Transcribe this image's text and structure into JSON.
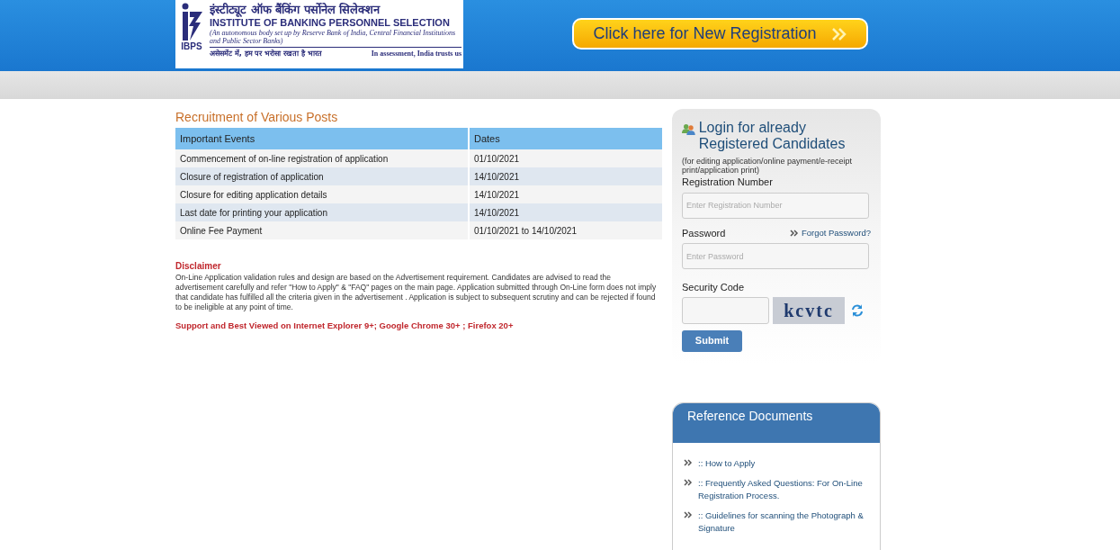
{
  "header": {
    "logo": {
      "mark": "IBPS",
      "hindi_title": "इंस्टीट्यूट ऑफ बैंकिंग पर्सोनेल सिलेक्शन",
      "title": "INSTITUTE OF BANKING PERSONNEL SELECTION",
      "subtitle": "(An autonomous body set up by Reserve Bank of India, Central Financial Institutions and Public Sector Banks)",
      "hindi_tagline": "असेसमेंट में, हम पर भरोसा रखता है भारत",
      "tagline": "In assessment, India trusts us"
    },
    "register_button": "Click here for New Registration"
  },
  "recruitment": {
    "title": "Recruitment of Various Posts",
    "columns": [
      "Important Events",
      "Dates"
    ],
    "rows": [
      [
        "Commencement of on-line registration of application",
        "01/10/2021"
      ],
      [
        "Closure of registration of application",
        "14/10/2021"
      ],
      [
        "Closure for editing application details",
        "14/10/2021"
      ],
      [
        "Last date for printing your application",
        "14/10/2021"
      ],
      [
        "Online Fee Payment",
        "01/10/2021 to 14/10/2021"
      ]
    ]
  },
  "disclaimer": {
    "title": "Disclaimer",
    "text": "On-Line Application validation rules and design are based on the Advertisement requirement. Candidates are advised to read the advertisement carefully and refer \"How to Apply\" & \"FAQ\" pages on the main page. Application submitted through On-Line form does not imply that candidate has fulfilled all the criteria given in the advertisement . Application is subject to subsequent scrutiny and can be rejected if found to be ineligible at any point of time.",
    "support": "Support and Best Viewed on Internet Explorer 9+; Google Chrome 30+ ; Firefox 20+"
  },
  "login": {
    "title": "Login for already Registered Candidates",
    "note": "(for editing application/online payment/e-receipt print/application print)",
    "registration_label": "Registration Number",
    "registration_placeholder": "Enter Registration Number",
    "password_label": "Password",
    "forgot_link": "Forgot Password?",
    "password_placeholder": "Enter Password",
    "security_label": "Security Code",
    "captcha": "kcvtc",
    "submit": "Submit"
  },
  "reference": {
    "title": "Reference Documents",
    "links": [
      ":: How to Apply",
      ":: Frequently Asked Questions: For On-Line Registration Process.",
      ":: Guidelines for scanning the Photograph & Signature"
    ]
  }
}
